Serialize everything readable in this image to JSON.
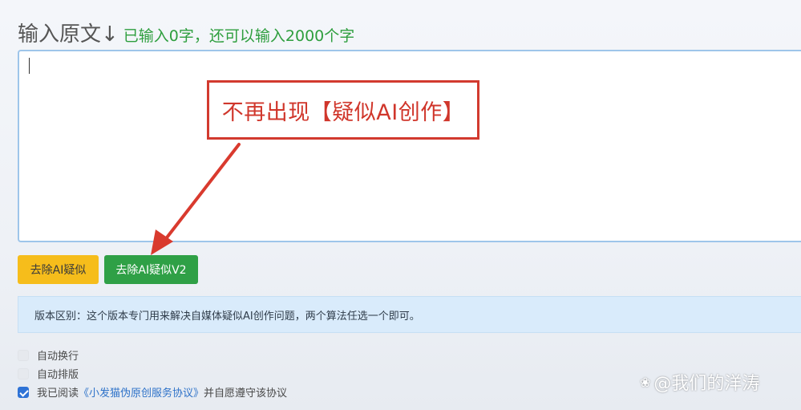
{
  "header": {
    "title": "输入原文↓",
    "counter": "已输入0字，还可以输入2000个字"
  },
  "editor": {
    "value": ""
  },
  "callout": {
    "text": "不再出现【疑似AI创作】"
  },
  "buttons": {
    "remove_ai": "去除AI疑似",
    "remove_ai_v2": "去除AI疑似V2"
  },
  "notice": {
    "text": "版本区别：这个版本专门用来解决自媒体疑似AI创作问题，两个算法任选一个即可。"
  },
  "options": {
    "auto_wrap": {
      "label": "自动换行",
      "checked": false
    },
    "auto_layout": {
      "label": "自动排版",
      "checked": false
    },
    "agreement": {
      "prefix": "我已阅读",
      "link": "《小发猫伪原创服务协议》",
      "suffix": "并自愿遵守该协议",
      "checked": true
    }
  },
  "watermark": {
    "icon": "paw-icon",
    "text": "@我们的洋涛"
  },
  "colors": {
    "yellow_button": "#f6bd1b",
    "green_button": "#2fa046",
    "counter_green": "#2e9e3e",
    "callout_red": "#d23a2f",
    "notice_bg": "#d9ebfb",
    "link_blue": "#2f73c9"
  }
}
